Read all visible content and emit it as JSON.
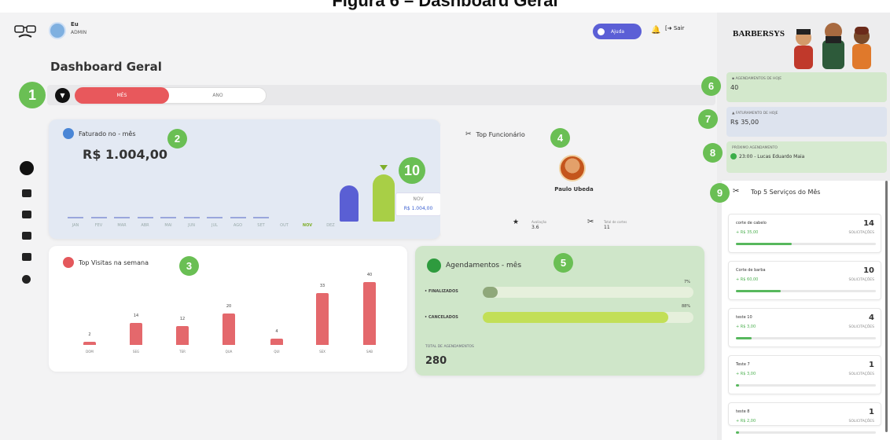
{
  "caption": "Figura 6 – Dashboard Geral",
  "topbar": {
    "user_name": "Eu",
    "user_role": "ADMIN",
    "help_label": "Ajuda",
    "logout_label": "Sair"
  },
  "page_title": "Dashboard Geral",
  "filter": {
    "options": [
      "MÊS",
      "ANO"
    ],
    "selected": "MÊS"
  },
  "faturado": {
    "title": "Faturado no - mês",
    "value": "R$ 1.004,00",
    "months": [
      "JAN",
      "FEV",
      "MAR",
      "ABR",
      "MAI",
      "JUN",
      "JUL",
      "AGO",
      "SET",
      "OUT",
      "NOV",
      "DEZ"
    ],
    "tooltip_month": "NOV",
    "tooltip_value": "R$ 1.004,00"
  },
  "top_funcionario": {
    "title": "Top Funcionário",
    "name": "Paulo Ubeda",
    "rating_label": "Avaliação",
    "rating": "3.6",
    "cuts_label": "Total de cortes",
    "cuts": "11"
  },
  "visitas": {
    "title": "Top Visitas na semana",
    "days": [
      "DOM",
      "SEG",
      "TER",
      "QUA",
      "QUI",
      "SEX",
      "SAB"
    ],
    "values": [
      2,
      14,
      12,
      20,
      4,
      33,
      40
    ]
  },
  "agendamentos_mes": {
    "title": "Agendamentos - mês",
    "rows": [
      {
        "label": "FINALIZADOS",
        "pct_text": "7%",
        "pct": 7
      },
      {
        "label": "CANCELADOS",
        "pct_text": "88%",
        "pct": 88
      }
    ],
    "total_label": "TOTAL DE AGENDAMENTOS",
    "total": "280"
  },
  "right": {
    "brand": "BARBERSYS",
    "agendamentos_hoje_label": "AGENDAMENTOS DE HOJE",
    "agendamentos_hoje": "40",
    "faturamento_hoje_label": "FATURAMENTO DE HOJE",
    "faturamento_hoje": "R$ 35,00",
    "proximo_label": "PRÓXIMO AGENDAMENTO",
    "proximo": "23:00 - Lucas Eduardo Maia",
    "top5_title": "Top 5 Serviços do Mês",
    "requests_label": "SOLICITAÇÕES",
    "services": [
      {
        "name": "corte de cabelo",
        "price": "+ R$ 35,00",
        "count": "14",
        "ratio": 0.4
      },
      {
        "name": "Corte de barba",
        "price": "+ R$ 60,00",
        "count": "10",
        "ratio": 0.32
      },
      {
        "name": "teste 10",
        "price": "+ R$ 3,00",
        "count": "4",
        "ratio": 0.11
      },
      {
        "name": "Teste 7",
        "price": "+ R$ 3,00",
        "count": "1",
        "ratio": 0.02
      },
      {
        "name": "teste 8",
        "price": "+ R$ 2,00",
        "count": "1",
        "ratio": 0.02
      }
    ]
  },
  "badges": [
    "1",
    "2",
    "3",
    "4",
    "5",
    "6",
    "7",
    "8",
    "9",
    "10"
  ],
  "colors": {
    "primary": "#e8585c",
    "blue": "#5a5fd4",
    "green": "#a8cf46",
    "badge": "#6abf54"
  }
}
